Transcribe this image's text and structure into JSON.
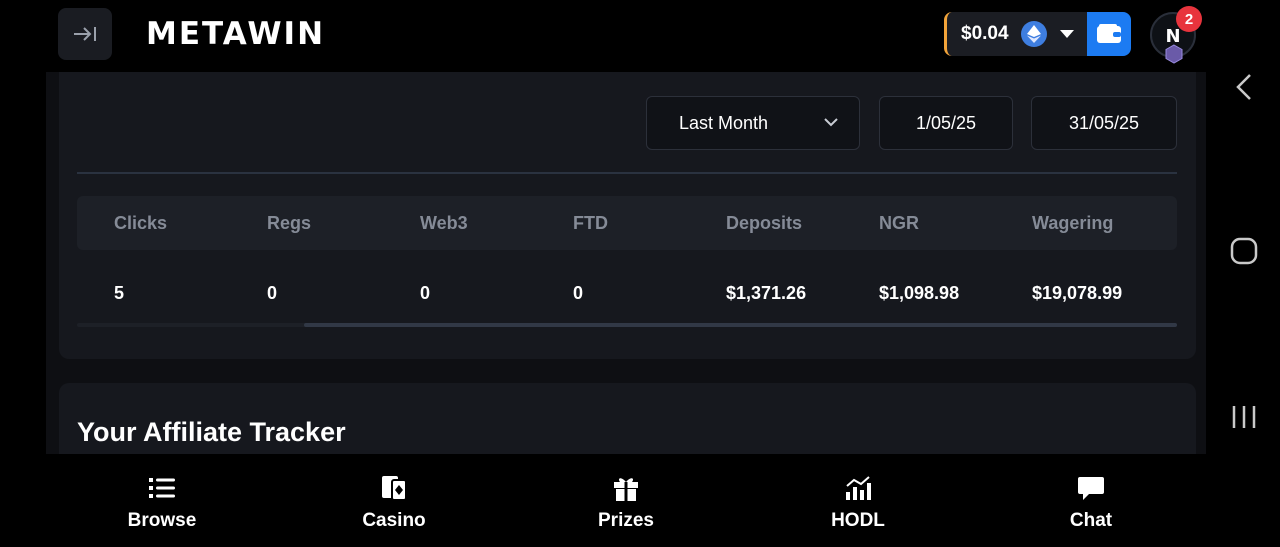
{
  "header": {
    "logo": "METAWIN",
    "balance": "$0.04",
    "currency_icon": "eth-icon",
    "notification_count": "2",
    "colors": {
      "wallet_accent": "#f2a43a",
      "wallet_button": "#1c7bf2",
      "badge": "#e8343d"
    }
  },
  "filters": {
    "period": "Last Month",
    "date_from": "1/05/25",
    "date_to": "31/05/25"
  },
  "stats_table": {
    "columns": [
      "Clicks",
      "Regs",
      "Web3",
      "FTD",
      "Deposits",
      "NGR",
      "Wagering"
    ],
    "row": [
      "5",
      "0",
      "0",
      "0",
      "$1,371.26",
      "$1,098.98",
      "$19,078.99"
    ]
  },
  "tracker": {
    "title": "Your Affiliate Tracker"
  },
  "bottom_nav": {
    "items": [
      {
        "label": "Browse",
        "icon": "list-icon"
      },
      {
        "label": "Casino",
        "icon": "cards-icon"
      },
      {
        "label": "Prizes",
        "icon": "gift-icon"
      },
      {
        "label": "HODL",
        "icon": "chart-icon"
      },
      {
        "label": "Chat",
        "icon": "chat-bubble-icon"
      }
    ]
  },
  "system_nav": {
    "buttons": [
      "back-icon",
      "home-icon",
      "recents-icon"
    ]
  }
}
